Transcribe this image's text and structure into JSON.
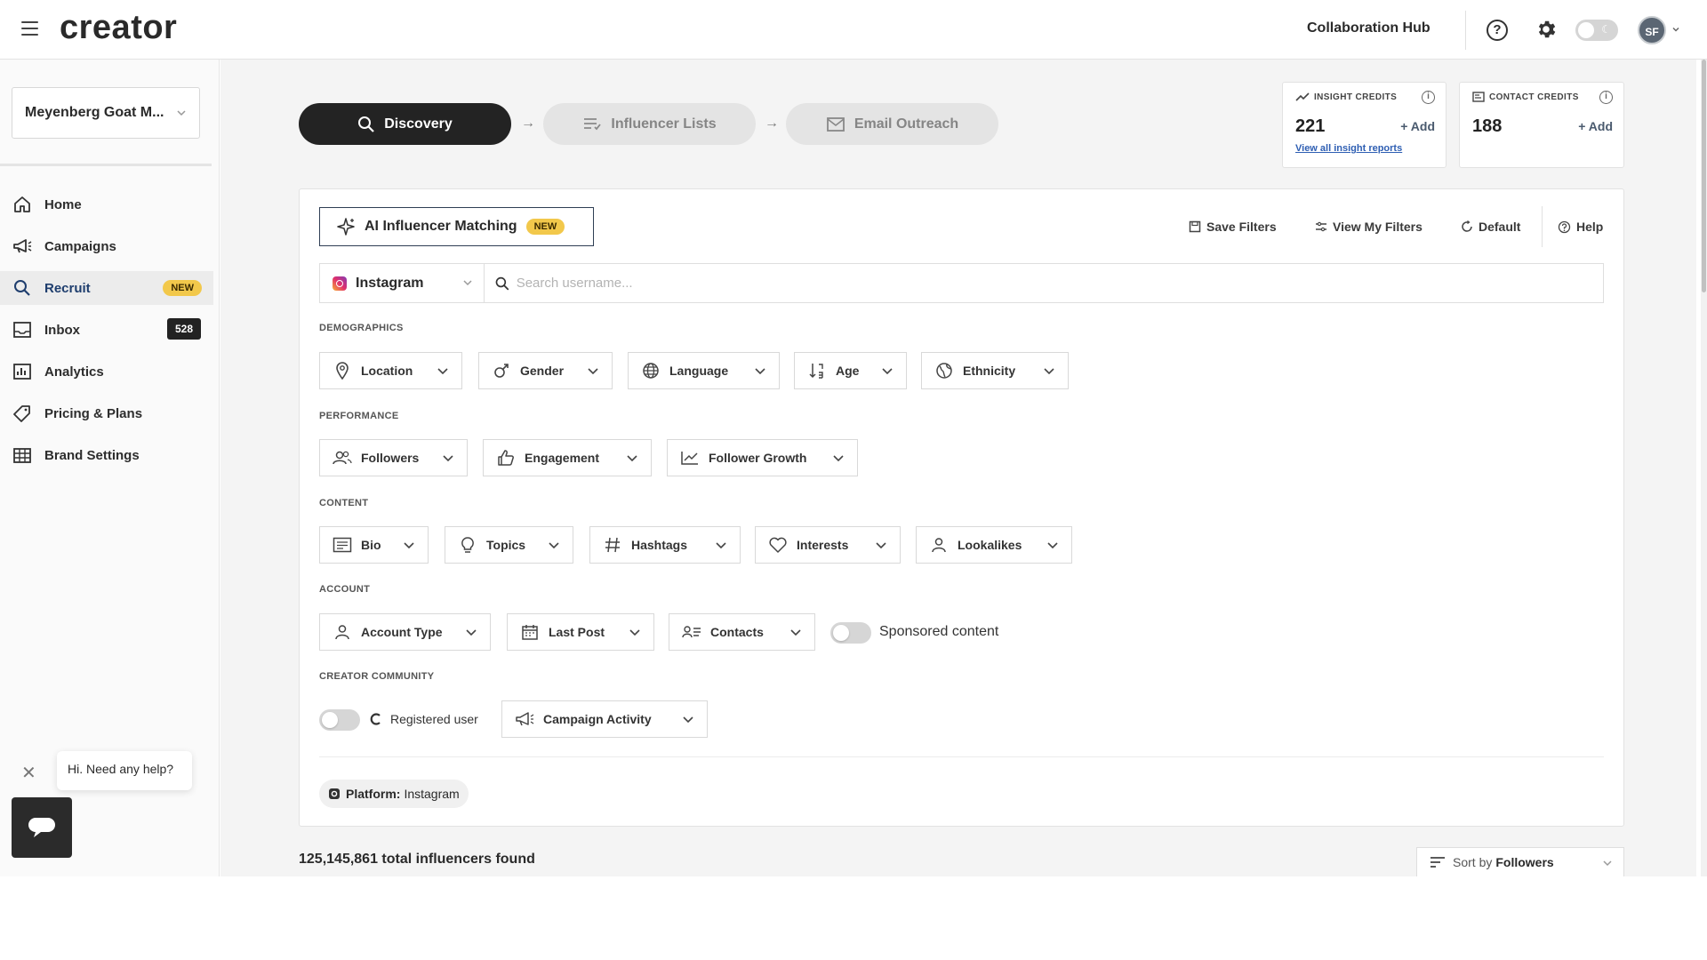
{
  "header": {
    "logo": "creator",
    "collab_hub": "Collaboration Hub",
    "help_glyph": "?",
    "avatar_initials": "SF"
  },
  "sidebar": {
    "brand": "Meyenberg Goat M...",
    "items": [
      {
        "label": "Home",
        "icon": "home-icon"
      },
      {
        "label": "Campaigns",
        "icon": "megaphone-icon"
      },
      {
        "label": "Recruit",
        "icon": "search-icon",
        "badge": "NEW",
        "active": true
      },
      {
        "label": "Inbox",
        "icon": "inbox-icon",
        "count": "528"
      },
      {
        "label": "Analytics",
        "icon": "analytics-icon"
      },
      {
        "label": "Pricing & Plans",
        "icon": "tag-icon"
      },
      {
        "label": "Brand Settings",
        "icon": "building-icon"
      }
    ],
    "chat_prompt": "Hi. Need any help?",
    "chat_close": "✕"
  },
  "steps": {
    "discovery": "Discovery",
    "influencer_lists": "Influencer Lists",
    "email_outreach": "Email Outreach",
    "arrow": "→"
  },
  "credits": {
    "insight": {
      "title": "INSIGHT CREDITS",
      "value": "221",
      "add": "+ Add",
      "link": "View all insight reports",
      "info": "i"
    },
    "contact": {
      "title": "CONTACT CREDITS",
      "value": "188",
      "add": "+ Add",
      "info": "i"
    }
  },
  "toolbar": {
    "ai_matching": "AI Influencer Matching",
    "new_badge": "NEW",
    "save_filters": "Save Filters",
    "view_my_filters": "View My Filters",
    "default": "Default",
    "help": "Help"
  },
  "search": {
    "platform": "Instagram",
    "placeholder": "Search username..."
  },
  "sections": {
    "demographics": "DEMOGRAPHICS",
    "performance": "PERFORMANCE",
    "content": "CONTENT",
    "account": "ACCOUNT",
    "creator_community": "CREATOR COMMUNITY"
  },
  "filters": {
    "demographics": [
      "Location",
      "Gender",
      "Language",
      "Age",
      "Ethnicity"
    ],
    "performance": [
      "Followers",
      "Engagement",
      "Follower Growth"
    ],
    "content": [
      "Bio",
      "Topics",
      "Hashtags",
      "Interests",
      "Lookalikes"
    ],
    "account": [
      "Account Type",
      "Last Post",
      "Contacts"
    ],
    "community": [
      "Campaign Activity"
    ]
  },
  "toggles": {
    "sponsored": "Sponsored content",
    "registered": "Registered user"
  },
  "applied": {
    "label": "Platform:",
    "value": "Instagram"
  },
  "results": {
    "total": "125,145,861 total influencers found",
    "sort_prefix": "Sort by",
    "sort_value": "Followers"
  },
  "colors": {
    "dark": "#232323",
    "badge_yellow": "#f2c84b",
    "link_blue": "#2f5fb3",
    "active_nav": "#1f3e6e"
  }
}
